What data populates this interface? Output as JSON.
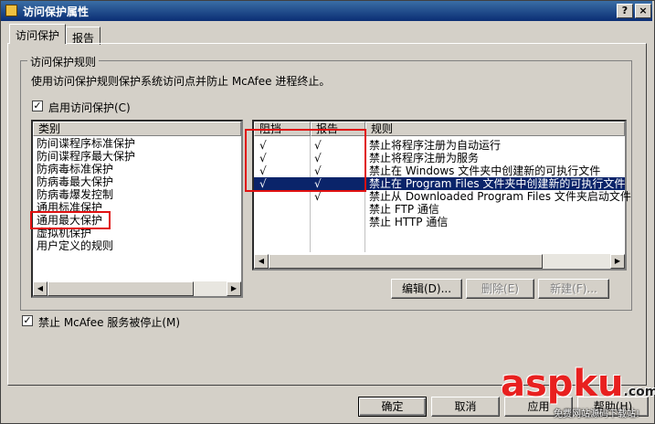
{
  "window": {
    "title": "访问保护属性",
    "help_label": "?",
    "close_label": "×"
  },
  "tabs": [
    {
      "label": "访问保护",
      "active": true
    },
    {
      "label": "报告",
      "active": false
    }
  ],
  "group": {
    "label": "访问保护规则",
    "description": "使用访问保护规则保护系统访问点并防止 McAfee 进程终止。"
  },
  "enable_checkbox": {
    "label": "启用访问保护(C)",
    "checked": true
  },
  "category_list": {
    "header": "类别",
    "items": [
      "防间谍程序标准保护",
      "防间谍程序最大保护",
      "防病毒标准保护",
      "防病毒最大保护",
      "防病毒爆发控制",
      "通用标准保护",
      "通用最大保护",
      "虚拟机保护",
      "用户定义的规则"
    ],
    "selected_index": 6
  },
  "rule_table": {
    "headers": [
      "阻挡",
      "报告",
      "规则"
    ],
    "rows": [
      {
        "block": "√",
        "report": "√",
        "rule": "禁止将程序注册为自动运行"
      },
      {
        "block": "√",
        "report": "√",
        "rule": "禁止将程序注册为服务"
      },
      {
        "block": "√",
        "report": "√",
        "rule": "禁止在 Windows 文件夹中创建新的可执行文件"
      },
      {
        "block": "√",
        "report": "√",
        "rule": "禁止在 Program Files 文件夹中创建新的可执行文件"
      },
      {
        "block": "",
        "report": "√",
        "rule": "禁止从 Downloaded Program Files 文件夹启动文件"
      },
      {
        "block": "",
        "report": "",
        "rule": "禁止 FTP 通信"
      },
      {
        "block": "",
        "report": "",
        "rule": "禁止 HTTP 通信"
      }
    ],
    "selected_index": 3
  },
  "rule_buttons": {
    "edit": "编辑(D)...",
    "delete": "删除(E)",
    "new": "新建(F)..."
  },
  "stop_checkbox": {
    "label": "禁止 McAfee 服务被停止(M)",
    "checked": true
  },
  "footer_buttons": {
    "ok": "确定",
    "cancel": "取消",
    "apply": "应用",
    "help": "帮助(H)"
  },
  "watermark": {
    "brand": "aspku",
    "suffix": ".com",
    "tagline": "免费网站源码下载站!"
  },
  "icons": {
    "check_glyph": "✓",
    "arrow_left": "◀",
    "arrow_right": "▶"
  }
}
